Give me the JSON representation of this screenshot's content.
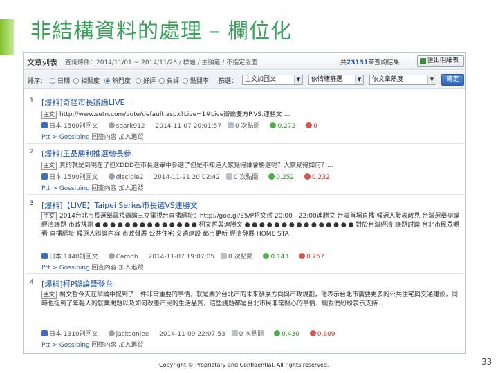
{
  "slide": {
    "title": "非結構資料的處理 – 欄位化",
    "copyright": "Copyright © Proprietary and Confidential. All rights reserved.",
    "page_number": "33",
    "accent_color": "#7fc12b",
    "title_color": "#3aa25a"
  },
  "screenshot": {
    "topbar": {
      "tab_title": "文章列表",
      "conditions": "查詢條件：2014/11/01 ~ 2014/11/28 / 標題 / 主頻道 / 不指定版面",
      "results_prefix": "共",
      "results_count": "23131",
      "results_suffix": "筆查詢結果",
      "export_label": "匯出明細表"
    },
    "sortbar": {
      "sort_label": "排序：",
      "options": [
        {
          "label": "日期",
          "selected": false
        },
        {
          "label": "相關度",
          "selected": false
        },
        {
          "label": "熱門度",
          "selected": true
        },
        {
          "label": "好評",
          "selected": false
        },
        {
          "label": "負評",
          "selected": false
        },
        {
          "label": "點閱率",
          "selected": false
        }
      ],
      "filter_label": "篩選：",
      "select1": "主文加回文",
      "select2": "依情緒篩選",
      "select3": "依文章熱度",
      "submit_label": "確定"
    },
    "entries": [
      {
        "index": "1",
        "title": "[爆料]奇怪市長辯論LIVE",
        "type": "主文",
        "snippet": "http://www.setn.com/vote/default.aspx?Live=1#Live辯論雙方P.VS.連勝文 ...",
        "board": "日本 1500則回文",
        "author": "sqark912",
        "time": "2014-11-07 20:01:57",
        "replies": "0 次點閱",
        "positive": "0.272",
        "negative": "0",
        "path": "Ptt > Gossiping",
        "actions": "回查內容 加入追蹤"
      },
      {
        "index": "2",
        "title": "[爆料]王晶勝利推選總長參",
        "type": "主文",
        "snippet": "真的就是到現在了但XDDD在市長選舉中參選了但是不知道大家覺得誰會勝選呢？大家覺得如何？...",
        "board": "日本 1590則回文",
        "author": "disciple2",
        "time": "2014-11-21 20:02:42",
        "replies": "0 次點閱",
        "positive": "0.252",
        "negative": "0.232",
        "path": "Ptt > Gossiping",
        "actions": "回查內容 加入追蹤"
      },
      {
        "index": "3",
        "title": "[爆料]【LIVE】Taipei Series市長選VS連勝文",
        "type": "主文",
        "snippet": "2014台北市長選舉電視辯論三立電視台直播網址：http://goo.gl/E5/P柯文哲 20:00 - 22:00連勝文 台灣首場直播 候選人發表政見 台灣選舉辯論 經濟議題 市政規劃 ● ● ● ● ● ● ● ● ● ● ● ● ● ● 柯文哲與連勝文 ● ● ● ● ● ● ● ● ● ● ● ● ● ● ● 對於台灣經濟 議題討論 台北市民眾觀看 直播網址 候選人辯論內容 市政發展 公共住宅 交通建設 都市更新 經濟發展 HOME STA",
        "board": "日本 1440則回文",
        "author": "Camdb",
        "time": "2014-11-07 19:07:05",
        "replies": "0 次點閱",
        "positive": "0.143",
        "negative": "0.257",
        "path": "Ptt > Gossiping",
        "actions": "回查內容 加入追蹤"
      },
      {
        "index": "4",
        "title": "[爆料]柯P辯論暨登台",
        "type": "主文",
        "snippet": "柯文哲今天在辯論中提到了一件非常重要的事情，就是關於台北市的未來發展方向與市政規劃，他表示台北市需要更多的公共住宅與交通建設，同時也提到了年輕人的就業問題以及如何改善市民的生活品質，這些議題都是台北市民非常關心的事情，網友們紛紛表示支持...",
        "board": "日本 1310則回文",
        "author": "jacksonlee",
        "time": "2014-11-09 22:07:53",
        "replies": "0 次點閱",
        "positive": "0.430",
        "negative": "0.609",
        "path": "Ptt > Gossiping",
        "actions": "回查內容 加入追蹤"
      }
    ]
  }
}
